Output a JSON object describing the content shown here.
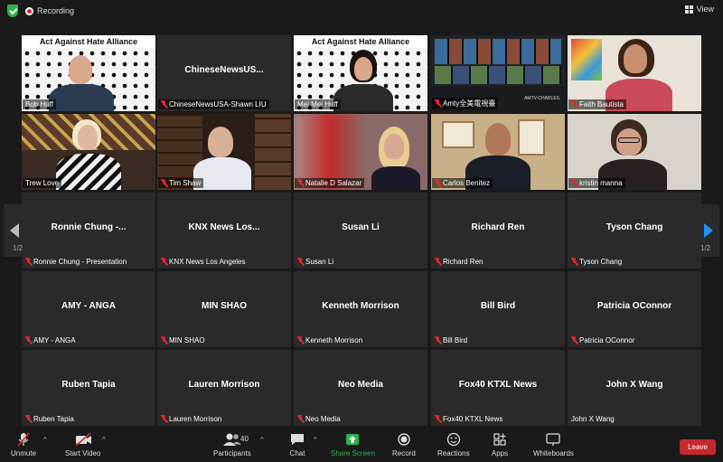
{
  "topbar": {
    "recording_label": "Recording",
    "view_label": "View"
  },
  "video_tiles": [
    {
      "label": "Bob Huff",
      "banner": "Act Against Hate Alliance",
      "muted": false
    },
    {
      "label": "ChineseNewsUSA-Shawn LIU",
      "center": "ChineseNewsUS...",
      "muted": true
    },
    {
      "label": "Mei Mei Huff",
      "banner": "Act Against Hate Alliance",
      "muted": false
    },
    {
      "label": "Amty全美電視臺",
      "overlay": "AMTV-CHARLES",
      "muted": true
    },
    {
      "label": "Faith Bautista",
      "muted": true
    },
    {
      "label": "Trew Love",
      "muted": false
    },
    {
      "label": "Tim Shaw",
      "muted": true
    },
    {
      "label": "Natalie D Salazar",
      "muted": true
    },
    {
      "label": "Carlos Benitez",
      "muted": true
    },
    {
      "label": "kristin manna",
      "muted": true
    }
  ],
  "name_tiles": [
    {
      "center": "Ronnie Chung -...",
      "label": "Ronnie Chung - Presentation",
      "muted": true
    },
    {
      "center": "KNX News Los...",
      "label": "KNX News Los Angeles",
      "muted": true
    },
    {
      "center": "Susan Li",
      "label": "Susan Li",
      "muted": true
    },
    {
      "center": "Richard Ren",
      "label": "Richard Ren",
      "muted": true
    },
    {
      "center": "Tyson Chang",
      "label": "Tyson Chang",
      "muted": true
    },
    {
      "center": "AMY - ANGA",
      "label": "AMY - ANGA",
      "muted": true
    },
    {
      "center": "MIN SHAO",
      "label": "MIN SHAO",
      "muted": true
    },
    {
      "center": "Kenneth Morrison",
      "label": "Kenneth Morrison",
      "muted": true
    },
    {
      "center": "Bill Bird",
      "label": "Bill Bird",
      "muted": true
    },
    {
      "center": "Patricia OConnor",
      "label": "Patricia OConnor",
      "muted": true
    },
    {
      "center": "Ruben Tapia",
      "label": "Ruben Tapia",
      "muted": true
    },
    {
      "center": "Lauren Morrison",
      "label": "Lauren Morrison",
      "muted": true
    },
    {
      "center": "Neo Media",
      "label": "Neo Media",
      "muted": true
    },
    {
      "center": "Fox40 KTXL News",
      "label": "Fox40 KTXL News",
      "muted": true
    },
    {
      "center": "John X Wang",
      "label": "John X Wang",
      "muted": false
    }
  ],
  "pagination": {
    "left": "1/2",
    "right": "1/2"
  },
  "toolbar": {
    "unmute": "Unmute",
    "start_video": "Start Video",
    "participants": "Participants",
    "participants_count": "40",
    "chat": "Chat",
    "share_screen": "Share Screen",
    "record": "Record",
    "reactions": "Reactions",
    "apps": "Apps",
    "whiteboards": "Whiteboards",
    "leave": "Leave"
  },
  "colors": {
    "accent_green": "#2bb24c",
    "leave_red": "#c5292a",
    "active_speaker": "#b6e06a",
    "page_arrow": "#1e90ff"
  }
}
